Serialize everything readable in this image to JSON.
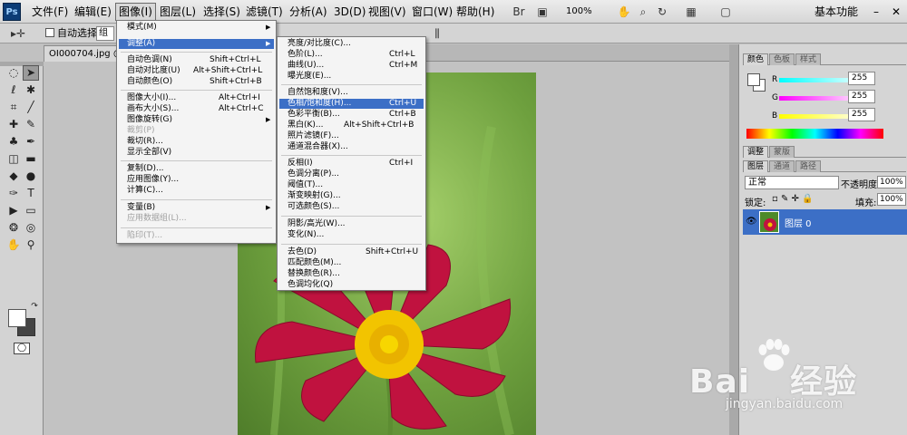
{
  "app": {
    "logo": "Ps"
  },
  "menubar": {
    "items": [
      "文件(F)",
      "编辑(E)",
      "图像(I)",
      "图层(L)",
      "选择(S)",
      "滤镜(T)",
      "分析(A)",
      "3D(D)",
      "视图(V)",
      "窗口(W)",
      "帮助(H)"
    ],
    "zoom": "100%",
    "workspace": "基本功能",
    "win_min": "–",
    "win_close": "✕"
  },
  "options_bar": {
    "auto_select_label": "自动选择:",
    "auto_select_value": "组"
  },
  "document": {
    "tab_title": "OI000704.jpg @ 1"
  },
  "image_menu": [
    {
      "label": "模式(M)",
      "shortcut": "",
      "submenu": true
    },
    {
      "label": "调整(A)",
      "shortcut": "",
      "submenu": true,
      "highlighted": true
    },
    {
      "label": "自动色调(N)",
      "shortcut": "Shift+Ctrl+L"
    },
    {
      "label": "自动对比度(U)",
      "shortcut": "Alt+Shift+Ctrl+L"
    },
    {
      "label": "自动颜色(O)",
      "shortcut": "Shift+Ctrl+B"
    },
    {
      "label": "图像大小(I)...",
      "shortcut": "Alt+Ctrl+I"
    },
    {
      "label": "画布大小(S)...",
      "shortcut": "Alt+Ctrl+C"
    },
    {
      "label": "图像旋转(G)",
      "shortcut": "",
      "submenu": true
    },
    {
      "label": "裁剪(P)",
      "shortcut": "",
      "disabled": true
    },
    {
      "label": "裁切(R)...",
      "shortcut": ""
    },
    {
      "label": "显示全部(V)",
      "shortcut": ""
    },
    {
      "label": "复制(D)...",
      "shortcut": ""
    },
    {
      "label": "应用图像(Y)...",
      "shortcut": ""
    },
    {
      "label": "计算(C)...",
      "shortcut": ""
    },
    {
      "label": "变量(B)",
      "shortcut": "",
      "submenu": true
    },
    {
      "label": "应用数据组(L)...",
      "shortcut": "",
      "disabled": true
    },
    {
      "label": "陷印(T)...",
      "shortcut": "",
      "disabled": true
    }
  ],
  "adjust_menu": [
    {
      "label": "亮度/对比度(C)...",
      "shortcut": ""
    },
    {
      "label": "色阶(L)...",
      "shortcut": "Ctrl+L"
    },
    {
      "label": "曲线(U)...",
      "shortcut": "Ctrl+M"
    },
    {
      "label": "曝光度(E)...",
      "shortcut": ""
    },
    {
      "label": "自然饱和度(V)...",
      "shortcut": ""
    },
    {
      "label": "色相/饱和度(H)...",
      "shortcut": "Ctrl+U",
      "highlighted": true
    },
    {
      "label": "色彩平衡(B)...",
      "shortcut": "Ctrl+B"
    },
    {
      "label": "黑白(K)...",
      "shortcut": "Alt+Shift+Ctrl+B"
    },
    {
      "label": "照片滤镜(F)...",
      "shortcut": ""
    },
    {
      "label": "通道混合器(X)...",
      "shortcut": ""
    },
    {
      "label": "反相(I)",
      "shortcut": "Ctrl+I"
    },
    {
      "label": "色调分离(P)...",
      "shortcut": ""
    },
    {
      "label": "阈值(T)...",
      "shortcut": ""
    },
    {
      "label": "渐变映射(G)...",
      "shortcut": ""
    },
    {
      "label": "可选颜色(S)...",
      "shortcut": ""
    },
    {
      "label": "阴影/高光(W)...",
      "shortcut": ""
    },
    {
      "label": "变化(N)...",
      "shortcut": ""
    },
    {
      "label": "去色(D)",
      "shortcut": "Shift+Ctrl+U"
    },
    {
      "label": "匹配颜色(M)...",
      "shortcut": ""
    },
    {
      "label": "替换颜色(R)...",
      "shortcut": ""
    },
    {
      "label": "色调均化(Q)",
      "shortcut": ""
    }
  ],
  "color_panel": {
    "tabs": [
      "颜色",
      "色板",
      "样式"
    ],
    "sliders": [
      {
        "label": "R",
        "value": "255",
        "color": "#ff4040"
      },
      {
        "label": "G",
        "value": "255",
        "color": "#00d000"
      },
      {
        "label": "B",
        "value": "255",
        "color": "#3050ff"
      }
    ]
  },
  "adjust_panel": {
    "tabs": [
      "调整",
      "蒙版"
    ]
  },
  "layers_panel": {
    "tabs": [
      "图层",
      "通道",
      "路径"
    ],
    "blend_mode": "正常",
    "opacity_label": "不透明度:",
    "opacity": "100%",
    "lock_label": "锁定:",
    "fill_label": "填充:",
    "fill": "100%",
    "layer_name": "图层 0"
  },
  "watermark": {
    "brand": "Bai",
    "brand2": "经验",
    "url": "jingyan.baidu.com"
  }
}
